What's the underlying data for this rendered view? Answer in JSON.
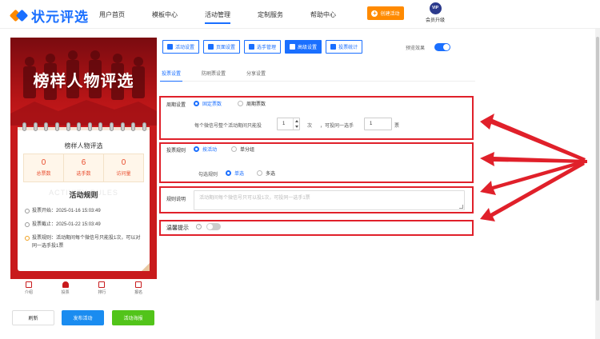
{
  "logo": {
    "text": "状元评选"
  },
  "nav": {
    "items": [
      {
        "label": "用户首页"
      },
      {
        "label": "模板中心"
      },
      {
        "label": "活动管理"
      },
      {
        "label": "定制服务"
      },
      {
        "label": "帮助中心"
      }
    ],
    "active": "活动管理",
    "create_label": "创建活动",
    "vip_badge": "VIP",
    "vip_label": "会员升级"
  },
  "preview": {
    "banner_title": "榜样人物评选",
    "card_title": "榜样人物评选",
    "stats": [
      {
        "value": "0",
        "label": "总票数"
      },
      {
        "value": "6",
        "label": "选手数"
      },
      {
        "value": "0",
        "label": "访问量"
      }
    ],
    "rules_watermark": "ACTIVITY RULES",
    "rules_title": "活动规则",
    "rules": [
      {
        "text": "投票开始：2025-01-16 15:03:49"
      },
      {
        "text": "投票截止：2025-01-22 15:03:49"
      },
      {
        "text": "投票规则：活动期间每个微信号只能投1次，可以对同一选手投1票"
      }
    ],
    "bottom_tabs": [
      {
        "label": "介绍"
      },
      {
        "label": "投票"
      },
      {
        "label": "排行"
      },
      {
        "label": "报名"
      }
    ]
  },
  "actions": {
    "refresh": "刷新",
    "publish": "发布活动",
    "poster": "活动海报"
  },
  "toolbar": {
    "items": [
      {
        "label": "活动设置"
      },
      {
        "label": "页面设置"
      },
      {
        "label": "选手管理"
      },
      {
        "label": "高级设置"
      },
      {
        "label": "投票统计"
      }
    ],
    "active": "高级设置",
    "preview_label": "预览效果",
    "preview_toggle": "on"
  },
  "subtabs": {
    "items": [
      {
        "label": "投票设置"
      },
      {
        "label": "防刷票设置"
      },
      {
        "label": "分享设置"
      }
    ],
    "active": "投票设置"
  },
  "form": {
    "cycle": {
      "label": "周期设置",
      "options": [
        "固定票数",
        "周期票数"
      ],
      "selected": "固定票数",
      "hint_prefix": "每个微信号整个活动期间只能投",
      "votes_value": "1",
      "unit_times": "次",
      "hint_mid": "，可投同一选手",
      "same_value": "1",
      "unit_votes": "票"
    },
    "rule": {
      "label": "投票规则",
      "options": [
        "按活动",
        "单分组"
      ],
      "selected": "按活动",
      "check_label": "勾选规则",
      "check_options": [
        "单选",
        "多选"
      ],
      "check_selected": "单选"
    },
    "desc": {
      "label": "规则说明",
      "placeholder": "活动期间每个微信号只可以投1次，可投同一选手1票"
    },
    "warm": {
      "label": "温馨提示",
      "help": "?",
      "toggle": "off"
    }
  },
  "colors": {
    "primary": "#1a6fff",
    "orange": "#ff8a00",
    "banner_red": "#c81a1c",
    "highlight_red": "#e0202a",
    "green": "#52c41a"
  }
}
